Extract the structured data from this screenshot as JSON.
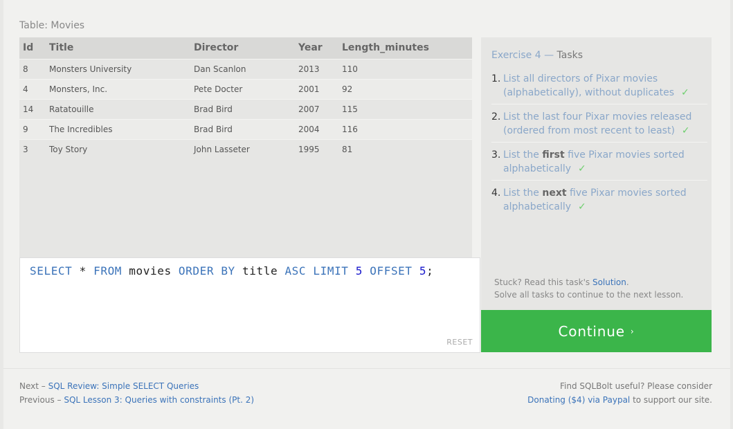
{
  "table_caption": "Table: Movies",
  "table": {
    "headers": [
      "Id",
      "Title",
      "Director",
      "Year",
      "Length_minutes"
    ],
    "rows": [
      [
        "8",
        "Monsters University",
        "Dan Scanlon",
        "2013",
        "110"
      ],
      [
        "4",
        "Monsters, Inc.",
        "Pete Docter",
        "2001",
        "92"
      ],
      [
        "14",
        "Ratatouille",
        "Brad Bird",
        "2007",
        "115"
      ],
      [
        "9",
        "The Incredibles",
        "Brad Bird",
        "2004",
        "116"
      ],
      [
        "3",
        "Toy Story",
        "John Lasseter",
        "1995",
        "81"
      ]
    ]
  },
  "editor": {
    "query_tokens": [
      {
        "t": "SELECT",
        "type": "kw"
      },
      {
        "t": " * ",
        "type": "text"
      },
      {
        "t": "FROM",
        "type": "kw"
      },
      {
        "t": " movies ",
        "type": "text"
      },
      {
        "t": "ORDER BY",
        "type": "kw"
      },
      {
        "t": " title ",
        "type": "text"
      },
      {
        "t": "ASC",
        "type": "kw"
      },
      {
        "t": " ",
        "type": "text"
      },
      {
        "t": "LIMIT",
        "type": "kw"
      },
      {
        "t": " ",
        "type": "text"
      },
      {
        "t": "5",
        "type": "num"
      },
      {
        "t": " ",
        "type": "text"
      },
      {
        "t": "OFFSET",
        "type": "kw"
      },
      {
        "t": " ",
        "type": "text"
      },
      {
        "t": "5",
        "type": "num"
      },
      {
        "t": ";",
        "type": "text"
      }
    ],
    "reset_label": "RESET"
  },
  "exercise": {
    "title": "Exercise 4",
    "sep": " — ",
    "subtitle": "Tasks",
    "tasks": [
      {
        "num": "1.",
        "before": "List all directors of Pixar movies (alphabetically), without duplicates",
        "bold": "",
        "after": "",
        "done": true
      },
      {
        "num": "2.",
        "before": "List the last four Pixar movies released (ordered from most recent to least)",
        "bold": "",
        "after": "",
        "done": true
      },
      {
        "num": "3.",
        "before": "List the ",
        "bold": "first",
        "after": " five Pixar movies sorted alphabetically",
        "done": true
      },
      {
        "num": "4.",
        "before": "List the ",
        "bold": "next",
        "after": " five Pixar movies sorted alphabetically",
        "done": true
      }
    ],
    "check_glyph": "✓",
    "hint_prefix": "Stuck? Read this task's ",
    "hint_link": "Solution",
    "hint_suffix": ".",
    "hint_line2": "Solve all tasks to continue to the next lesson.",
    "continue_label": "Continue",
    "continue_chevron": "›"
  },
  "footer": {
    "next_prefix": "Next – ",
    "next_link": "SQL Review: Simple SELECT Queries",
    "prev_prefix": "Previous – ",
    "prev_link": "SQL Lesson 3: Queries with constraints (Pt. 2)",
    "promo_line1": "Find SQLBolt useful? Please consider",
    "promo_link": "Donating ($4) via Paypal",
    "promo_suffix": " to support our site."
  }
}
